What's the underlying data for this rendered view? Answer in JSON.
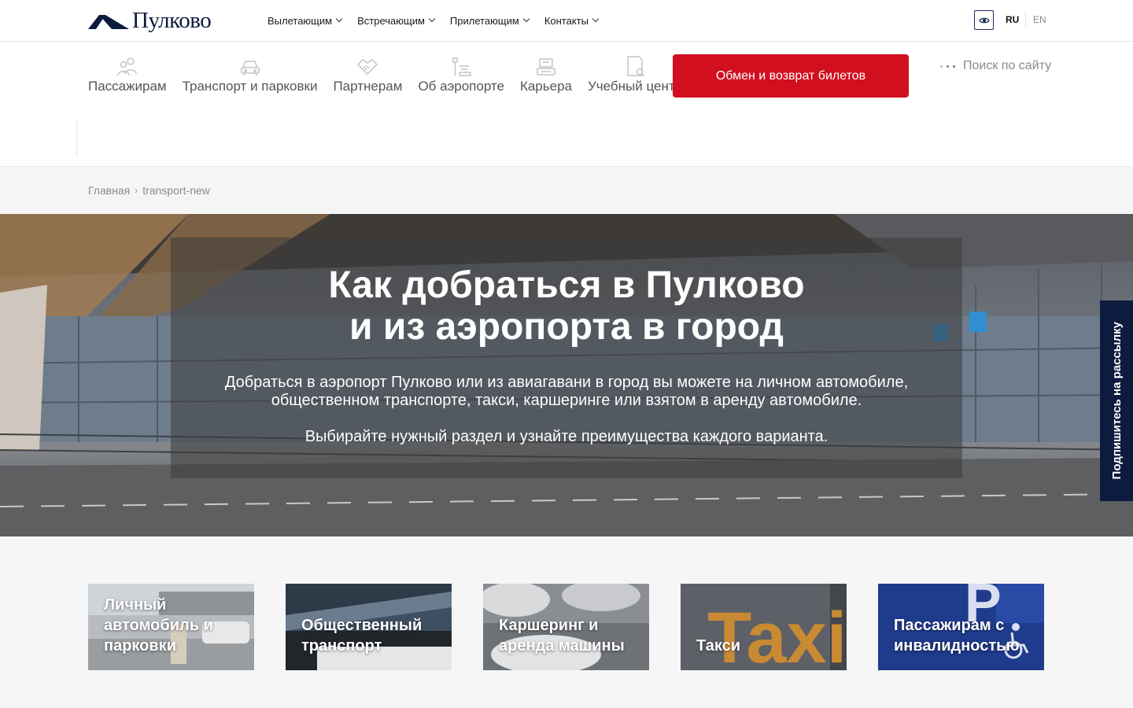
{
  "brand": {
    "name": "Пулково",
    "primary": "#0d1b3e",
    "accent": "#d10f1f"
  },
  "topnav": {
    "items": [
      {
        "label": "Вылетающим"
      },
      {
        "label": "Встречающим"
      },
      {
        "label": "Прилетающим"
      },
      {
        "label": "Контакты"
      }
    ],
    "accessibility_icon": "eye-icon",
    "lang_ru": "RU",
    "lang_en": "EN"
  },
  "mainnav": {
    "items": [
      {
        "label": "Пассажирам",
        "icon": "passengers-icon"
      },
      {
        "label": "Транспорт и парковки",
        "icon": "car-icon"
      },
      {
        "label": "Партнерам",
        "icon": "handshake-icon"
      },
      {
        "label": "Об аэропорте",
        "icon": "airport-icon"
      },
      {
        "label": "Карьера",
        "icon": "career-icon"
      },
      {
        "label": "Учебный центр",
        "icon": "study-icon"
      }
    ],
    "exchange_button": "Обмен и возврат билетов",
    "search_placeholder": "Поиск по сайту"
  },
  "breadcrumb": {
    "home": "Главная",
    "current": "transport-new"
  },
  "hero": {
    "title_line1": "Как добраться в Пулково",
    "title_line2": "и из аэропорта в город",
    "text_line1": "Добраться в аэропорт Пулково или из авиагавани в город вы можете на личном автомобиле,",
    "text_line2": "общественном транспорте, такси, каршеринге или взятом в аренду автомобиле.",
    "text2": "Выбирайте нужный раздел и узнайте преимущества каждого варианта."
  },
  "subscribe_label": "Подпишитесь на рассылку",
  "cards": [
    {
      "title": "Личный автомобиль и парковки"
    },
    {
      "title": "Общественный транспорт"
    },
    {
      "title": "Каршеринг и аренда машины"
    },
    {
      "title": "Такси",
      "image_text": "Taxi"
    },
    {
      "title": "Пассажирам с инвалидностью"
    }
  ]
}
